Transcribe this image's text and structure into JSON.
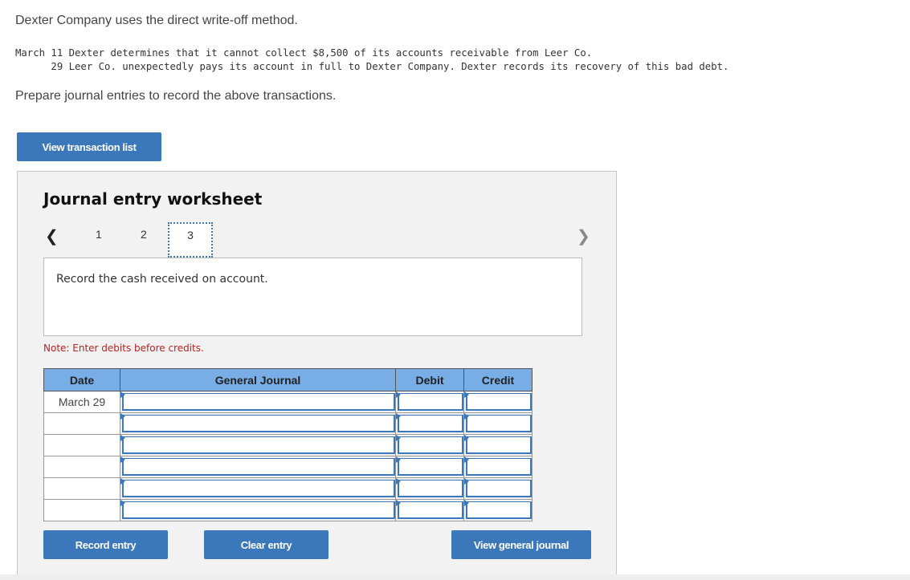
{
  "problem": {
    "intro": "Dexter Company uses the direct write-off method.",
    "transactions": [
      "March 11 Dexter determines that it cannot collect $8,500 of its accounts receivable from Leer Co.",
      "      29 Leer Co. unexpectedly pays its account in full to Dexter Company. Dexter records its recovery of this bad debt."
    ],
    "prompt": "Prepare journal entries to record the above transactions."
  },
  "buttons": {
    "view_transaction_list": "View transaction list",
    "record_entry": "Record entry",
    "clear_entry": "Clear entry",
    "view_general_journal": "View general journal"
  },
  "worksheet": {
    "title": "Journal entry worksheet",
    "nav_prev_icon": "chevron-left",
    "nav_next_icon": "chevron-right",
    "steps": [
      "1",
      "2",
      "3"
    ],
    "active_step": "3",
    "description": "Record the cash received on account.",
    "note": "Note: Enter debits before credits.",
    "table": {
      "headers": [
        "Date",
        "General Journal",
        "Debit",
        "Credit"
      ],
      "rows": [
        {
          "date": "March 29",
          "account": "",
          "debit": "",
          "credit": ""
        },
        {
          "date": "",
          "account": "",
          "debit": "",
          "credit": ""
        },
        {
          "date": "",
          "account": "",
          "debit": "",
          "credit": ""
        },
        {
          "date": "",
          "account": "",
          "debit": "",
          "credit": ""
        },
        {
          "date": "",
          "account": "",
          "debit": "",
          "credit": ""
        },
        {
          "date": "",
          "account": "",
          "debit": "",
          "credit": ""
        }
      ]
    }
  }
}
